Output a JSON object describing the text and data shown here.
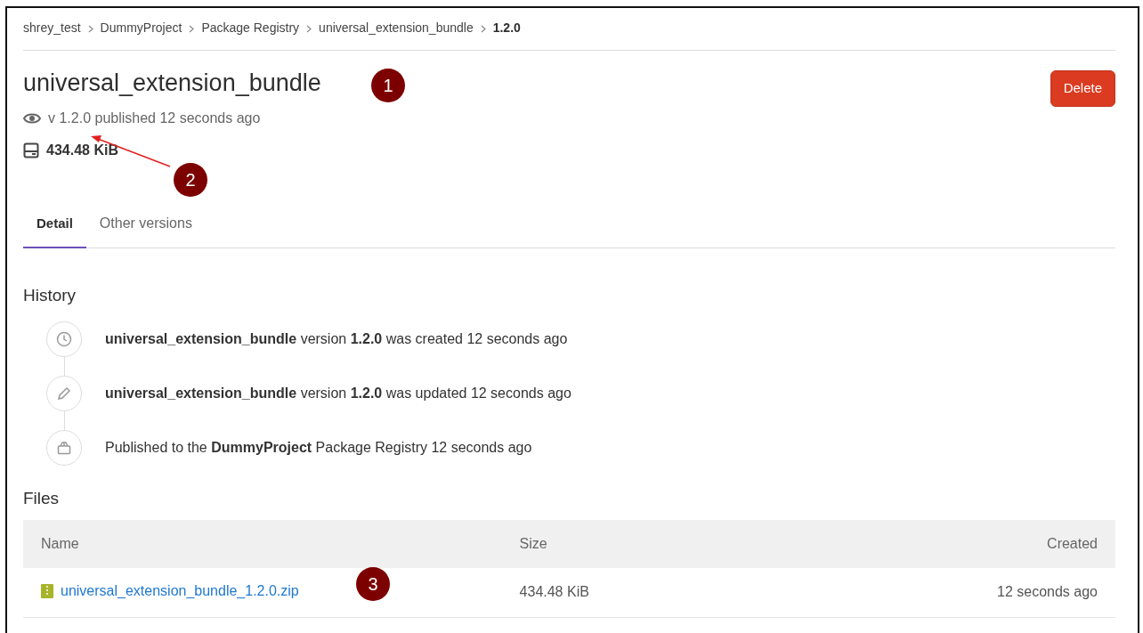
{
  "breadcrumbs": [
    {
      "label": "shrey_test",
      "current": false
    },
    {
      "label": "DummyProject",
      "current": false
    },
    {
      "label": "Package Registry",
      "current": false
    },
    {
      "label": "universal_extension_bundle",
      "current": false
    },
    {
      "label": "1.2.0",
      "current": true
    }
  ],
  "package": {
    "title": "universal_extension_bundle",
    "version_line": "v 1.2.0 published 12 seconds ago",
    "size": "434.48 KiB",
    "delete_button": "Delete"
  },
  "tabs": [
    {
      "label": "Detail",
      "selected": true
    },
    {
      "label": "Other versions",
      "selected": false
    }
  ],
  "history": {
    "title": "History",
    "entries": [
      {
        "kind": "created",
        "text": "**universal_extension_bundle** version **1.2.0** was created 12 seconds ago"
      },
      {
        "kind": "updated",
        "text": "**universal_extension_bundle** version **1.2.0** was updated 12 seconds ago"
      },
      {
        "kind": "published",
        "text": "Published to the **DummyProject** Package Registry 12 seconds ago"
      }
    ]
  },
  "files": {
    "title": "Files",
    "columns": [
      "Name",
      "Size",
      "Created"
    ],
    "rows": [
      {
        "name": "universal_extension_bundle_1.2.0.zip",
        "size": "434.48 KiB",
        "created": "12 seconds ago"
      }
    ]
  },
  "annotations": [
    "1",
    "2",
    "3"
  ]
}
